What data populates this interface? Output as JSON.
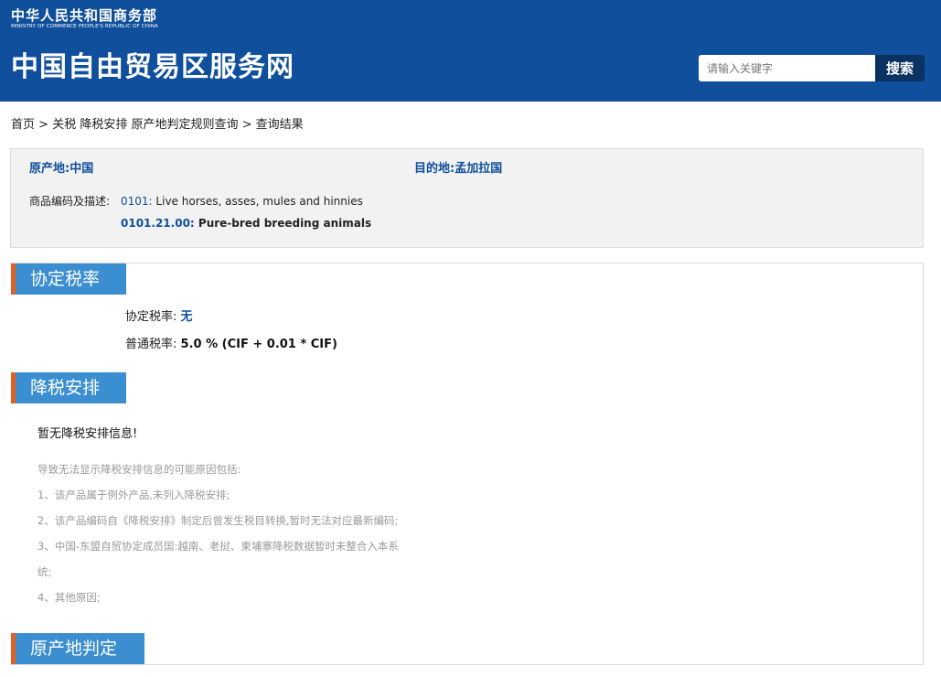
{
  "header": {
    "ministry_cn": "中华人民共和国商务部",
    "ministry_en": "MINISTRY OF COMMERCE PEOPLE'S REPUBLIC OF CHINA",
    "site_title": "中国自由贸易区服务网",
    "search": {
      "placeholder": "请输入关键字",
      "button_label": "搜索"
    },
    "colors": {
      "header_bg": "#0f4f9b",
      "search_button_bg": "#0b3361"
    }
  },
  "breadcrumb": {
    "items": [
      "首页",
      "关税 降税安排 原产地判定规则查询",
      "查询结果"
    ],
    "separator": ">"
  },
  "info": {
    "origin_label": "原产地:",
    "origin_value": "中国",
    "destination_label": "目的地:",
    "destination_value": "孟加拉国",
    "goods_label": "商品编码及描述:",
    "goods": [
      {
        "code": "0101:",
        "description": "Live horses, asses, mules and hinnies"
      },
      {
        "code": "0101.21.00:",
        "description": "Pure-bred breeding animals"
      }
    ]
  },
  "sections": {
    "agreed_rate": {
      "title": "协定税率",
      "agreed_label": "协定税率:",
      "agreed_value": "无",
      "general_label": "普通税率:",
      "general_value": "5.0 % (CIF + 0.01 * CIF)"
    },
    "tariff_reduction": {
      "title": "降税安排",
      "no_info": "暂无降税安排信息!",
      "reasons_intro": "导致无法显示降税安排信息的可能原因包括:",
      "reasons": [
        "1、该产品属于例外产品,未列入降税安排;",
        "2、该产品编码自《降税安排》制定后曾发生税目转换,暂时无法对应最新编码;",
        "3、中国-东盟自贸协定成员国:越南、老挝、柬埔寨降税数据暂时未整合入本系",
        "统;",
        "4、其他原因;"
      ]
    },
    "origin_determination": {
      "title": "原产地判定"
    }
  },
  "colors": {
    "section_tab_bg": "#3b8fd0",
    "section_tab_accent": "#e45f1e",
    "link_blue": "#0f4f9b",
    "muted_text": "#999999"
  }
}
